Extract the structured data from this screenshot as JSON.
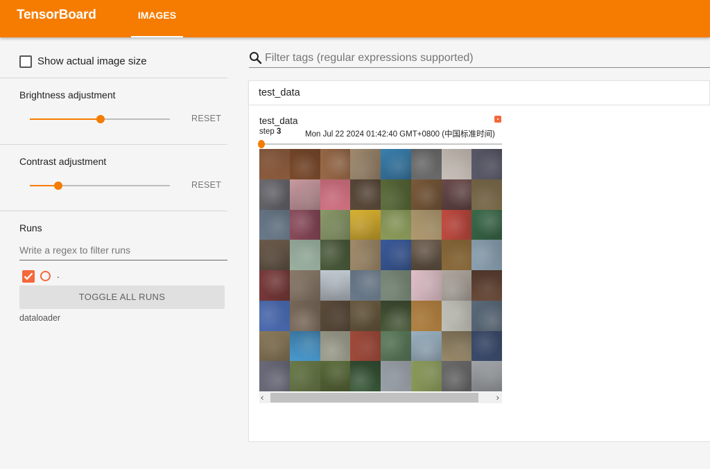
{
  "header": {
    "brand": "TensorBoard",
    "tab_label": "IMAGES",
    "accent_color": "#f57c00"
  },
  "sidebar": {
    "show_actual_size_label": "Show actual image size",
    "show_actual_size_checked": false,
    "brightness": {
      "label": "Brightness adjustment",
      "reset_label": "RESET",
      "value": 0.5
    },
    "contrast": {
      "label": "Contrast adjustment",
      "reset_label": "RESET",
      "value": 0.2
    },
    "runs": {
      "title": "Runs",
      "filter_placeholder": "Write a regex to filter runs",
      "items": [
        {
          "name": ".",
          "checked": true,
          "color": "#f4683b"
        }
      ],
      "toggle_all_label": "TOGGLE ALL RUNS",
      "folder_label": "dataloader"
    }
  },
  "main": {
    "filter_placeholder": "Filter tags (regular expressions supported)",
    "category_title": "test_data",
    "card": {
      "title": "test_data",
      "step_label": "step",
      "step_value": "3",
      "timestamp": "Mon Jul 22 2024 01:42:40 GMT+0800 (中国标准时间)"
    },
    "image_grid_colors": [
      "#8a5a3c",
      "#7a4a2c",
      "#9a6a48",
      "#a08a70",
      "#3a7fae",
      "#6a6a6a",
      "#c8c0b8",
      "#5a5a6a",
      "#6a6a70",
      "#c89aa0",
      "#d07080",
      "#5a4a3a",
      "#5a6a3a",
      "#7a5a3a",
      "#6a4a4a",
      "#7a6a4a",
      "#6a7a8a",
      "#8a4a5a",
      "#8a9a6a",
      "#d8b030",
      "#8a9a5a",
      "#b09a70",
      "#c04a40",
      "#3a6a4a",
      "#6a5a4a",
      "#9ab0a0",
      "#4a5a3a",
      "#a08a6a",
      "#3a5a9a",
      "#6a5a4a",
      "#8a6a3a",
      "#8aa0b0",
      "#7a3a3a",
      "#8a7a6a",
      "#c0c8d0",
      "#6a7a8a",
      "#7a8a7a",
      "#e0c0c8",
      "#b0a8a0",
      "#6a4a3a",
      "#4a6ab0",
      "#7a6a5a",
      "#5a4a3a",
      "#6a5a40",
      "#4a5a3a",
      "#b08040",
      "#c0c0b8",
      "#5a6a7a",
      "#8a7a5a",
      "#4a9ad0",
      "#9a9a8a",
      "#a04a3a",
      "#5a7a5a",
      "#9ab0c0",
      "#9a8a6a",
      "#3a4a6a",
      "#6a6a7a",
      "#6a7a4a",
      "#5a6a3a",
      "#3a5a3a",
      "#9aa0a8",
      "#8a9a5a",
      "#6a6a6a",
      "#a0a4a8"
    ]
  }
}
